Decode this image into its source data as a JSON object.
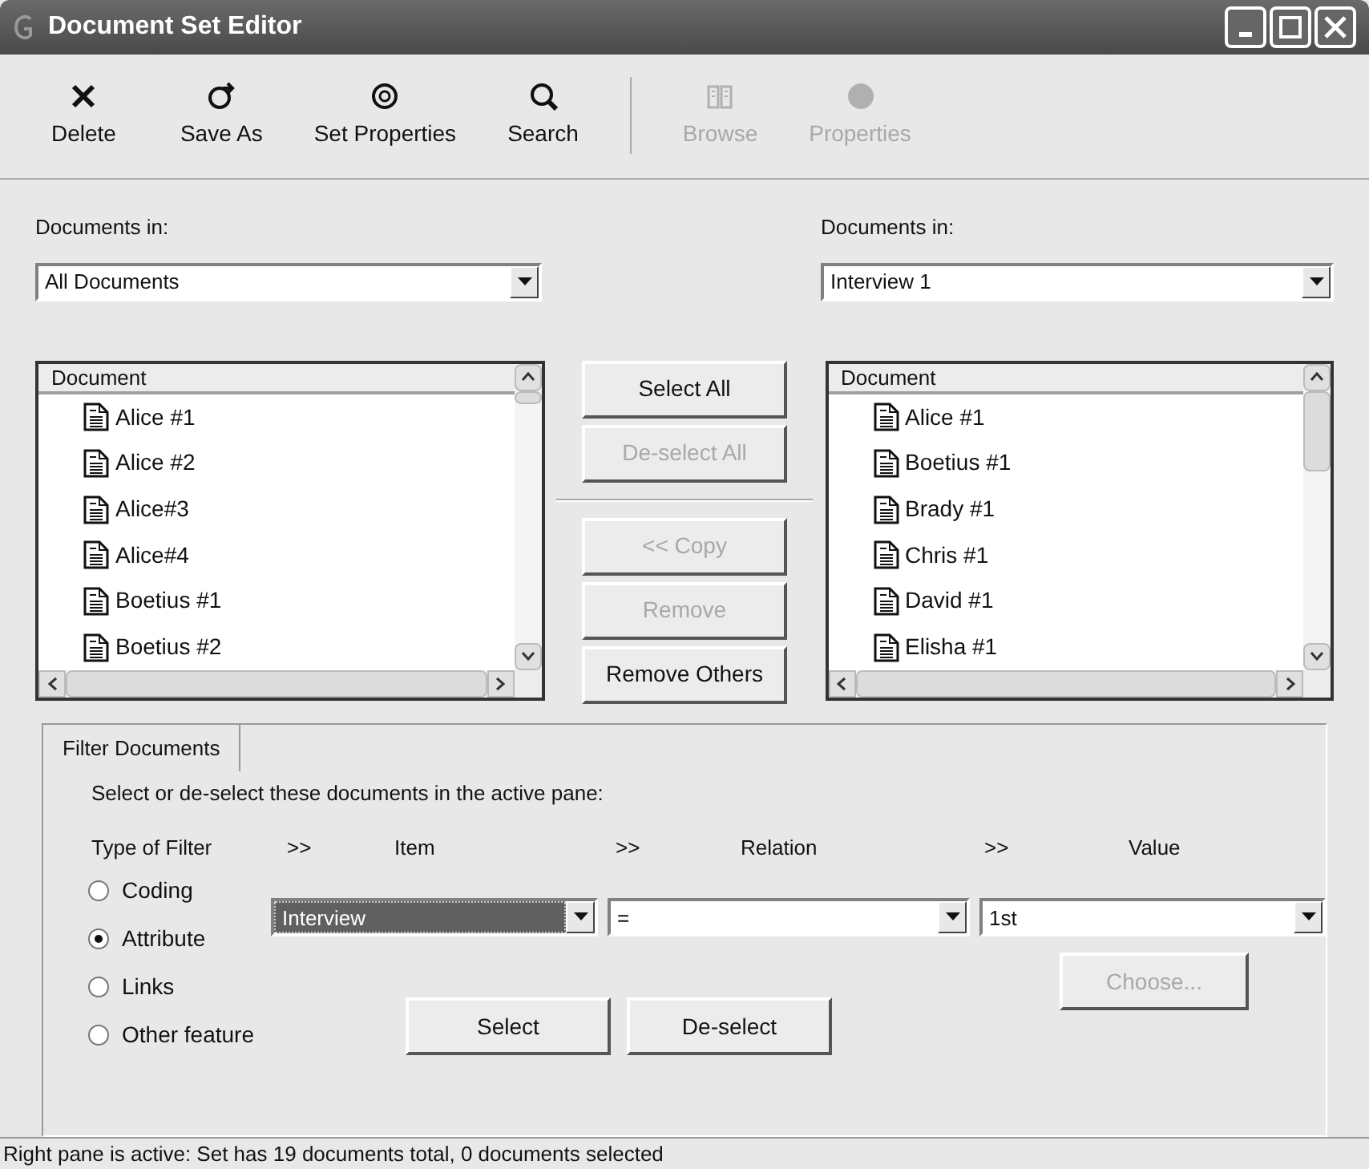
{
  "window": {
    "title": "Document Set Editor"
  },
  "toolbar": [
    {
      "label": "Delete",
      "kind": "delete",
      "disabled": false
    },
    {
      "label": "Save As",
      "kind": "saveas",
      "disabled": false
    },
    {
      "label": "Set Properties",
      "kind": "setprops",
      "disabled": false
    },
    {
      "label": "Search",
      "kind": "search",
      "disabled": false
    },
    {
      "label": "Browse",
      "kind": "browse",
      "disabled": true
    },
    {
      "label": "Properties",
      "kind": "props",
      "disabled": true
    }
  ],
  "left_pane": {
    "label": "Documents in:",
    "combo": "All Documents",
    "column": "Document",
    "rows": [
      "Alice #1",
      "Alice #2",
      "Alice#3",
      "Alice#4",
      "Boetius #1",
      "Boetius #2"
    ]
  },
  "middle_buttons": [
    {
      "label": "Select All",
      "disabled": false
    },
    {
      "label": "De-select All",
      "disabled": true
    },
    {
      "label": "<< Copy",
      "disabled": true
    },
    {
      "label": "Remove",
      "disabled": true
    },
    {
      "label": "Remove Others",
      "disabled": false
    }
  ],
  "right_pane": {
    "label": "Documents in:",
    "combo": "Interview 1",
    "column": "Document",
    "rows": [
      "Alice #1",
      "Boetius #1",
      "Brady #1",
      "Chris #1",
      "David #1",
      "Elisha #1"
    ]
  },
  "filter": {
    "tab": "Filter Documents",
    "instruction": "Select or de-select these documents in the active pane:",
    "headings": [
      "Type of Filter",
      ">>",
      "Item",
      ">>",
      "Relation",
      ">>",
      "Value"
    ],
    "types": [
      {
        "label": "Coding",
        "selected": false
      },
      {
        "label": "Attribute",
        "selected": true
      },
      {
        "label": "Links",
        "selected": false
      },
      {
        "label": "Other feature",
        "selected": false
      }
    ],
    "item": "Interview",
    "relation": "=",
    "value": "1st",
    "choose": {
      "label": "Choose...",
      "disabled": true
    },
    "buttons": [
      "Select",
      "De-select"
    ]
  },
  "status_bar": "Right pane is active: Set has 19 documents total, 0 documents selected"
}
